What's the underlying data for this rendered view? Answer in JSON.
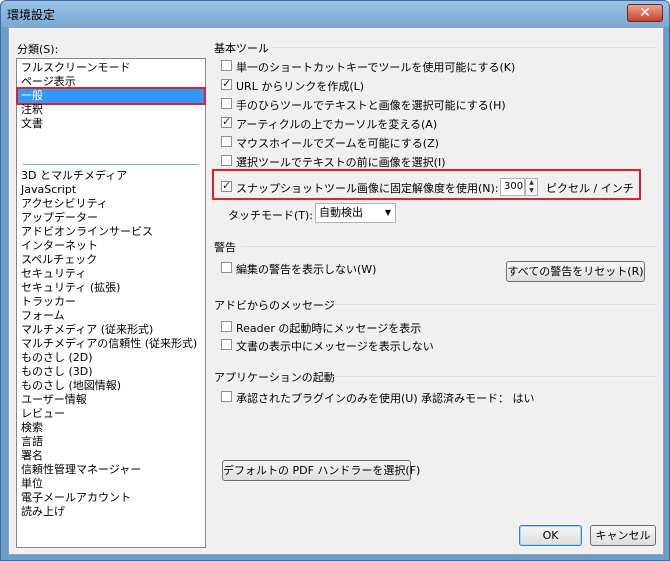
{
  "window": {
    "title": "環境設定",
    "close_glyph": "✕"
  },
  "categories": {
    "label": "分類(S):",
    "top_items": [
      "フルスクリーンモード",
      "ページ表示",
      "一般",
      "注釈",
      "文書"
    ],
    "selected": "一般",
    "items": [
      "3D とマルチメディア",
      "JavaScript",
      "アクセシビリティ",
      "アップデーター",
      "アドビオンラインサービス",
      "インターネット",
      "スペルチェック",
      "セキュリティ",
      "セキュリティ (拡張)",
      "トラッカー",
      "フォーム",
      "マルチメディア (従来形式)",
      "マルチメディアの信頼性 (従来形式)",
      "ものさし (2D)",
      "ものさし (3D)",
      "ものさし (地図情報)",
      "ユーザー情報",
      "レビュー",
      "検索",
      "言語",
      "署名",
      "信頼性管理マネージャー",
      "単位",
      "電子メールアカウント",
      "読み上げ"
    ]
  },
  "basic_tools": {
    "title": "基本ツール",
    "options": [
      {
        "label": "単一のショートカットキーでツールを使用可能にする(K)",
        "checked": false
      },
      {
        "label": "URL からリンクを作成(L)",
        "checked": true
      },
      {
        "label": "手のひらツールでテキストと画像を選択可能にする(H)",
        "checked": false
      },
      {
        "label": "アーティクルの上でカーソルを変える(A)",
        "checked": true
      },
      {
        "label": "マウスホイールでズームを可能にする(Z)",
        "checked": false
      },
      {
        "label": "選択ツールでテキストの前に画像を選択(I)",
        "checked": false
      }
    ],
    "snapshot": {
      "label": "スナップショットツール画像に固定解像度を使用(N):",
      "checked": true,
      "value": "300",
      "unit": "ピクセル / インチ"
    },
    "touch_mode": {
      "label": "タッチモード(T):",
      "value": "自動検出"
    }
  },
  "warnings": {
    "title": "警告",
    "option": {
      "label": "編集の警告を表示しない(W)",
      "checked": false
    },
    "reset_button": "すべての警告をリセット(R)"
  },
  "adobe_messages": {
    "title": "アドビからのメッセージ",
    "options": [
      {
        "label": "Reader の起動時にメッセージを表示",
        "checked": false
      },
      {
        "label": "文書の表示中にメッセージを表示しない",
        "checked": false
      }
    ]
  },
  "app_startup": {
    "title": "アプリケーションの起動",
    "option": {
      "label": "承認されたプラグインのみを使用(U)",
      "checked": false
    },
    "approved_mode": "承認済みモード： はい",
    "pdf_handler_button": "デフォルトの PDF ハンドラーを選択(F)"
  },
  "footer": {
    "ok": "OK",
    "cancel": "キャンセル"
  }
}
